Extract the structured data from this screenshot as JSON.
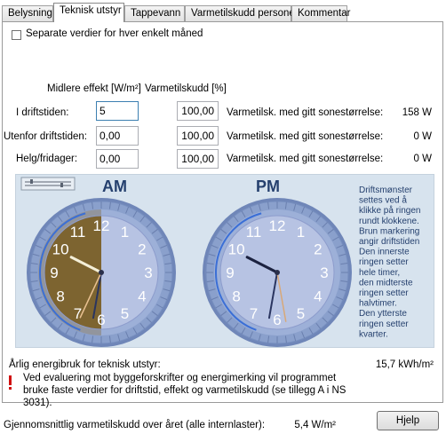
{
  "tabs": [
    {
      "label": "Belysning"
    },
    {
      "label": "Teknisk utstyr"
    },
    {
      "label": "Tappevann"
    },
    {
      "label": "Varmetilskudd personer"
    },
    {
      "label": "Kommentar"
    }
  ],
  "separate_checkbox": {
    "label": "Separate verdier for hver enkelt måned",
    "checked": false
  },
  "columns": {
    "effect": "Midlere effekt [W/m²]",
    "heat": "Varmetilskudd [%]"
  },
  "rows": [
    {
      "label": "I driftstiden:",
      "effect": "5",
      "heat": "100,00",
      "result_label": "Varmetilsk. med gitt sonestørrelse:",
      "result": "158 W"
    },
    {
      "label": "Utenfor driftstiden:",
      "effect": "0,00",
      "heat": "100,00",
      "result_label": "Varmetilsk. med gitt sonestørrelse:",
      "result": "0 W"
    },
    {
      "label": "Helg/fridager:",
      "effect": "0,00",
      "heat": "100,00",
      "result_label": "Varmetilsk. med gitt sonestørrelse:",
      "result": "0 W"
    }
  ],
  "clocks": {
    "am_label": "AM",
    "pm_label": "PM",
    "numbers": [
      "12",
      "1",
      "2",
      "3",
      "4",
      "5",
      "6",
      "7",
      "8",
      "9",
      "10",
      "11"
    ],
    "help_lines": [
      "Driftsmønster",
      "settes ved å",
      "klikke på ringen",
      "rundt klokkene.",
      "Brun markering",
      "angir driftstiden",
      "Den innerste",
      "ringen setter",
      "hele timer,",
      "den midterste",
      "ringen setter",
      "halvtimer.",
      "Den ytterste",
      "ringen setter",
      "kvarter."
    ],
    "colors": {
      "operating": "#7d6430",
      "outer_ring": "#8aa0cc",
      "face_light": "#b7c3e3",
      "accent": "#3b6fd6"
    }
  },
  "annual": {
    "label": "Årlig energibruk for teknisk utstyr:",
    "value": "15,7 kWh/m²"
  },
  "warning": {
    "icon": "exclamation-icon",
    "text": "Ved evaluering mot byggeforskrifter og energimerking vil programmet bruke faste verdier for driftstid, effekt og varmetilskudd (se tillegg A i NS 3031)."
  },
  "footer": {
    "label": "Gjennomsnittlig varmetilskudd over året (alle internlaster):",
    "value": "5,4 W/m²",
    "help_button": "Hjelp"
  }
}
